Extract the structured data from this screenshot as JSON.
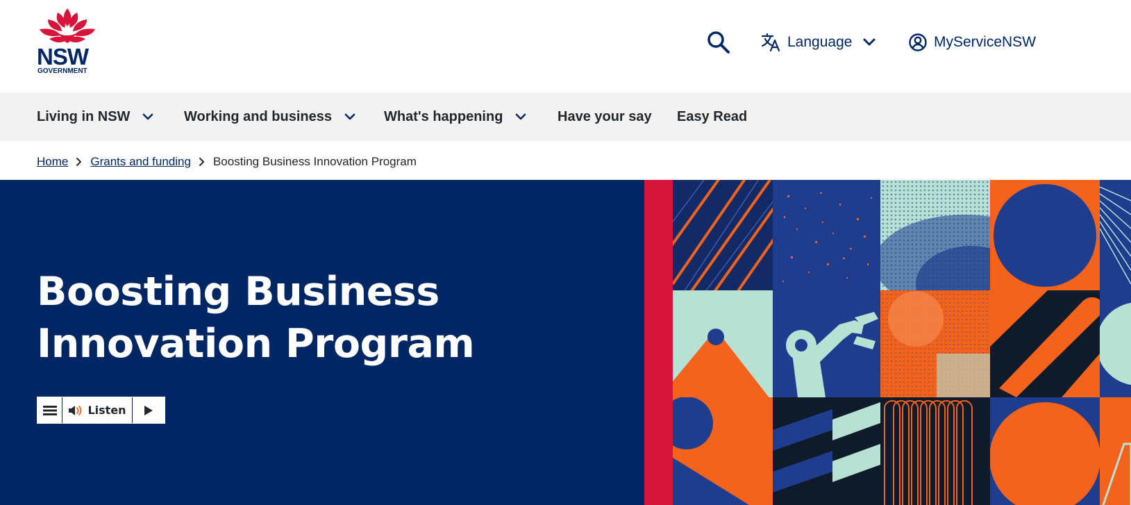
{
  "brand": {
    "logo_text": "NSW",
    "logo_subtext": "GOVERNMENT",
    "colors": {
      "navy": "#002664",
      "red": "#d7153a",
      "orange": "#f3631b",
      "mint": "#b7e2d3",
      "blue": "#1e3d8f",
      "nav_bg": "#f2f2f2"
    }
  },
  "header": {
    "search_icon": "search-icon",
    "language_label": "Language",
    "language_icon": "translate-icon",
    "account_label": "MyServiceNSW",
    "account_icon": "user-circle-icon"
  },
  "nav": {
    "items": [
      {
        "label": "Living in NSW",
        "has_dropdown": true
      },
      {
        "label": "Working and business",
        "has_dropdown": true
      },
      {
        "label": "What's happening",
        "has_dropdown": true
      },
      {
        "label": "Have your say",
        "has_dropdown": false
      },
      {
        "label": "Easy Read",
        "has_dropdown": false
      }
    ]
  },
  "breadcrumb": {
    "home": "Home",
    "parent": "Grants and funding",
    "current": "Boosting Business Innovation Program"
  },
  "hero": {
    "title_line1": "Boosting Business",
    "title_line2": "Innovation Program",
    "listen_label": "Listen"
  }
}
